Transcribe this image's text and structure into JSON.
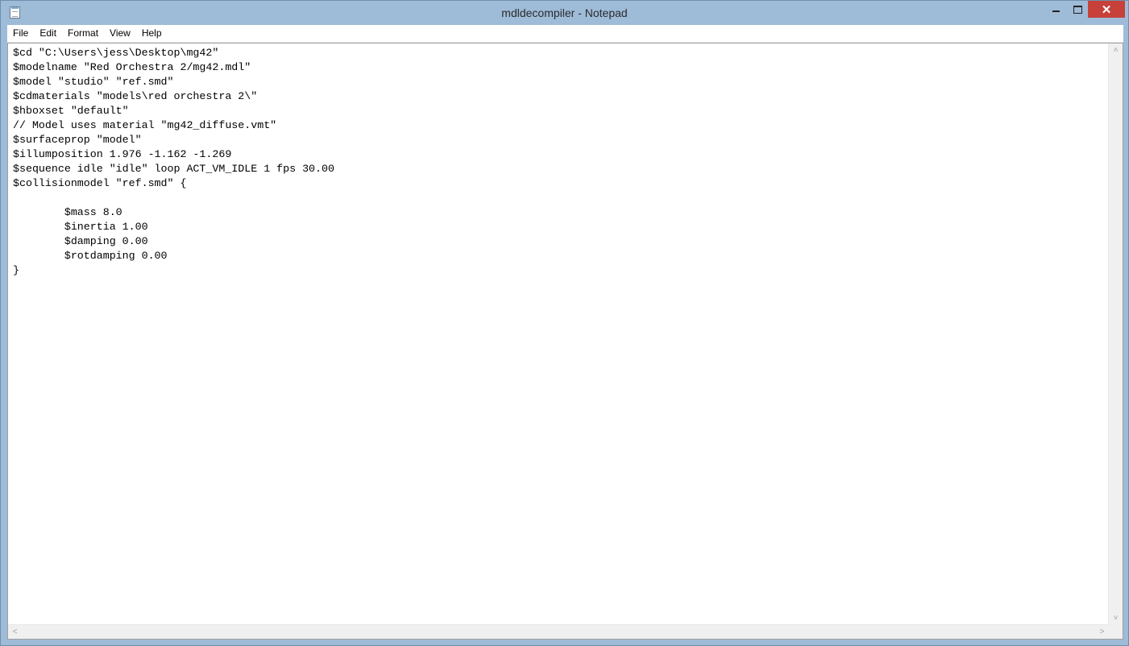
{
  "window": {
    "title": "mdldecompiler - Notepad",
    "close_glyph": "✕"
  },
  "menu": {
    "items": [
      "File",
      "Edit",
      "Format",
      "View",
      "Help"
    ]
  },
  "editor": {
    "content": "$cd \"C:\\Users\\jess\\Desktop\\mg42\"\n$modelname \"Red Orchestra 2/mg42.mdl\"\n$model \"studio\" \"ref.smd\"\n$cdmaterials \"models\\red orchestra 2\\\"\n$hboxset \"default\"\n// Model uses material \"mg42_diffuse.vmt\"\n$surfaceprop \"model\"\n$illumposition 1.976 -1.162 -1.269\n$sequence idle \"idle\" loop ACT_VM_IDLE 1 fps 30.00\n$collisionmodel \"ref.smd\" {\n\n\t$mass 8.0\n\t$inertia 1.00\n\t$damping 0.00\n\t$rotdamping 0.00\n}"
  },
  "scrollbars": {
    "up_glyph": "˄",
    "down_glyph": "˅",
    "left_glyph": "<",
    "right_glyph": ">"
  },
  "colors": {
    "titlebar": "#9ebbd8",
    "close_button": "#c7403a"
  }
}
